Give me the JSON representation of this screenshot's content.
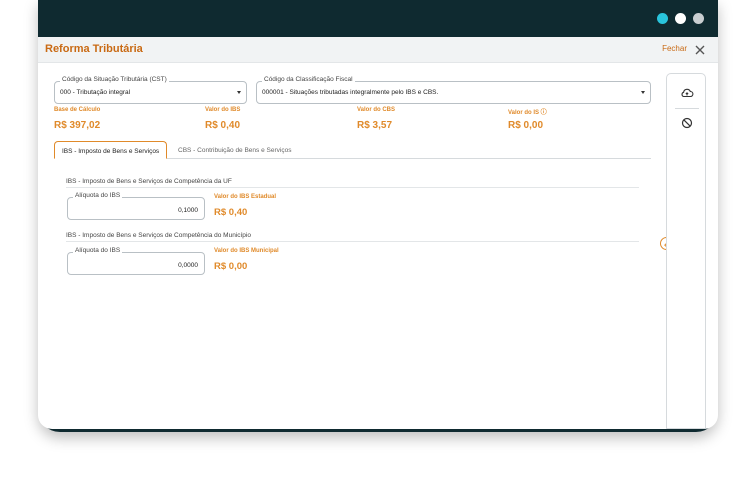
{
  "window": {
    "title": "Reforma Tributária",
    "close_label": "Fechar"
  },
  "cst": {
    "label": "Código da Situação Tributária (CST)",
    "value": "000 - Tributação integral"
  },
  "class_fiscal": {
    "label": "Código da Classificação Fiscal",
    "value": "000001 - Situações tributadas integralmente pelo IBS e CBS."
  },
  "totals": [
    {
      "label": "Base de Cálculo",
      "value": "R$ 397,02"
    },
    {
      "label": "Valor do IBS",
      "value": "R$ 0,40"
    },
    {
      "label": "Valor do CBS",
      "value": "R$ 3,57"
    },
    {
      "label": "Valor do IS ⓘ",
      "value": "R$ 0,00"
    }
  ],
  "tabs": [
    {
      "label": "IBS - Imposto de Bens e Serviços",
      "active": true
    },
    {
      "label": "CBS - Contribuição de Bens e Serviços",
      "active": false
    }
  ],
  "ibs_uf": {
    "section_title": "IBS - Imposto de Bens e Serviços de Competência da UF",
    "aliquota_label": "Alíquota do IBS",
    "aliquota_value": "0,1000",
    "valor_label": "Valor do IBS Estadual",
    "valor_value": "R$ 0,40"
  },
  "ibs_mun": {
    "section_title": "IBS - Imposto de Bens e Serviços de Competência do Município",
    "aliquota_label": "Alíquota do IBS",
    "aliquota_value": "0,0000",
    "valor_label": "Valor do IBS Municipal",
    "valor_value": "R$ 0,00"
  },
  "sidebar": {
    "icons": [
      "cloud-upload-icon",
      "block-icon"
    ]
  },
  "colors": {
    "accent": "#e08a2a",
    "title": "#c96a14",
    "frame": "#0f2a30",
    "dot_active": "#29c4dc",
    "dot": "#ffffff",
    "dot_dim": "#c9ced1"
  }
}
